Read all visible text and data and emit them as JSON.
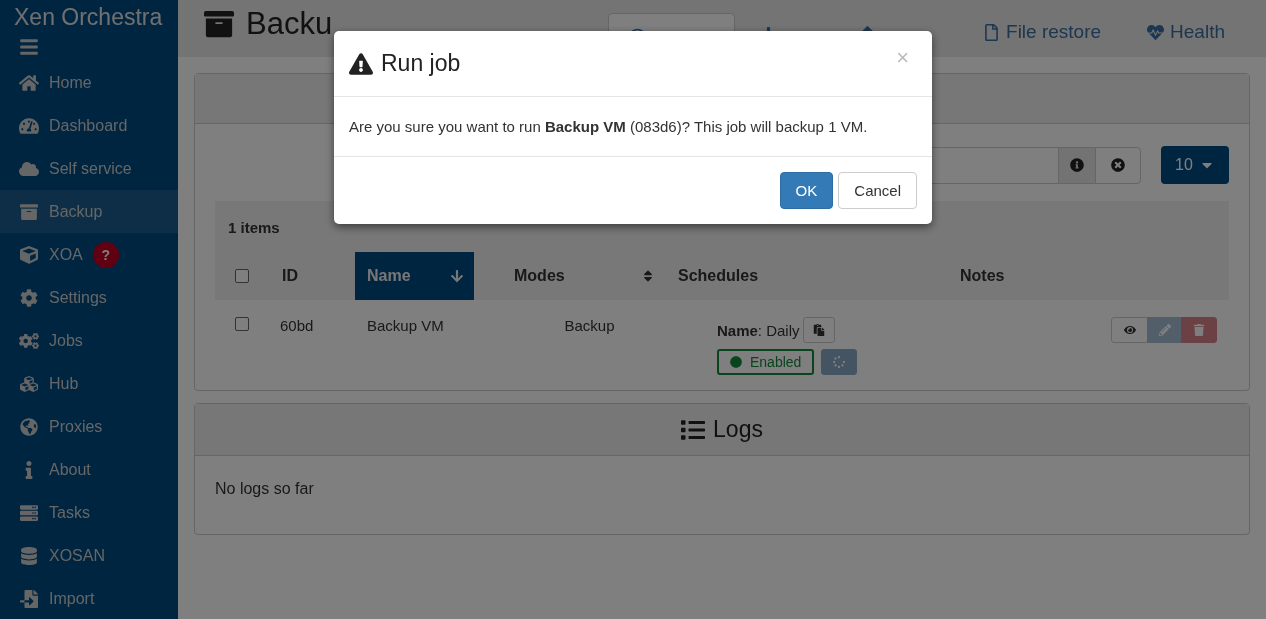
{
  "app_title": "Xen Orchestra",
  "sidebar": {
    "items": [
      {
        "label": "Home",
        "selected": false
      },
      {
        "label": "Dashboard",
        "selected": false
      },
      {
        "label": "Self service",
        "selected": false
      },
      {
        "label": "Backup",
        "selected": true
      },
      {
        "label": "XOA",
        "selected": false,
        "badge": "?"
      },
      {
        "label": "Settings",
        "selected": false
      },
      {
        "label": "Jobs",
        "selected": false
      },
      {
        "label": "Hub",
        "selected": false
      },
      {
        "label": "Proxies",
        "selected": false
      },
      {
        "label": "About",
        "selected": false
      },
      {
        "label": "Tasks",
        "selected": false
      },
      {
        "label": "XOSAN",
        "selected": false
      },
      {
        "label": "Import",
        "selected": false
      }
    ]
  },
  "page": {
    "title": "Backu",
    "tabs": [
      {
        "selected": true
      },
      {
        "selected": false
      },
      {
        "selected": false
      },
      {
        "label": "File restore",
        "selected": false
      },
      {
        "label": "Health",
        "selected": false
      }
    ]
  },
  "jobs": {
    "page_size": "10",
    "count": "1 items",
    "select_all": {
      "checked": false
    },
    "columns": [
      {
        "label": "ID",
        "selected": false,
        "sortable": false
      },
      {
        "label": "Name",
        "selected": true,
        "sortable": true
      },
      {
        "label": "Modes",
        "selected": false,
        "sortable": true
      },
      {
        "label": "Schedules",
        "selected": false,
        "sortable": false
      },
      {
        "label": "Notes",
        "selected": false,
        "sortable": false
      }
    ],
    "rows": [
      {
        "checked": false,
        "id": "60bd",
        "name": "Backup VM",
        "mode": "Backup",
        "schedule": {
          "name": "**Name**: Daily",
          "enabled": true,
          "status": "Enabled"
        }
      }
    ]
  },
  "logs": {
    "title": "Logs",
    "empty": "No logs so far"
  },
  "dialog": {
    "title": "Run job",
    "close": "×",
    "message": "Are you sure you want to run **Backup VM** (083d6)? This job will backup 1 VM.",
    "buttons": [
      {
        "label": "OK",
        "primary": true
      },
      {
        "label": "Cancel",
        "primary": false
      }
    ]
  }
}
